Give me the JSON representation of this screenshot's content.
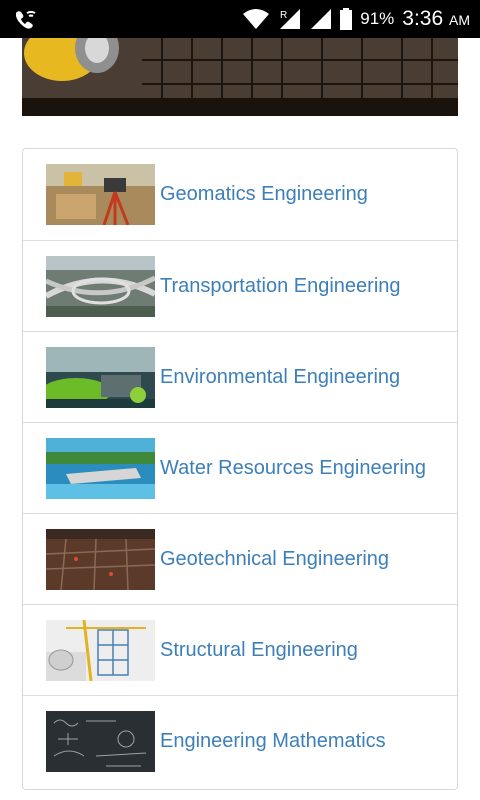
{
  "status_bar": {
    "battery_percent": "91%",
    "time": "3:36",
    "ampm": "AM",
    "roaming_indicator": "R"
  },
  "banner": {
    "image": "construction-site-banner"
  },
  "items": [
    {
      "label": "Geomatics Engineering",
      "image": "surveying-instrument-image"
    },
    {
      "label": "Transportation Engineering",
      "image": "highway-interchange-image"
    },
    {
      "label": "Environmental Engineering",
      "image": "green-city-image"
    },
    {
      "label": "Water Resources Engineering",
      "image": "dam-reservoir-image"
    },
    {
      "label": "Geotechnical Engineering",
      "image": "excavation-site-image"
    },
    {
      "label": "Structural Engineering",
      "image": "building-blueprint-image"
    },
    {
      "label": "Engineering Mathematics",
      "image": "math-chalkboard-image"
    }
  ]
}
